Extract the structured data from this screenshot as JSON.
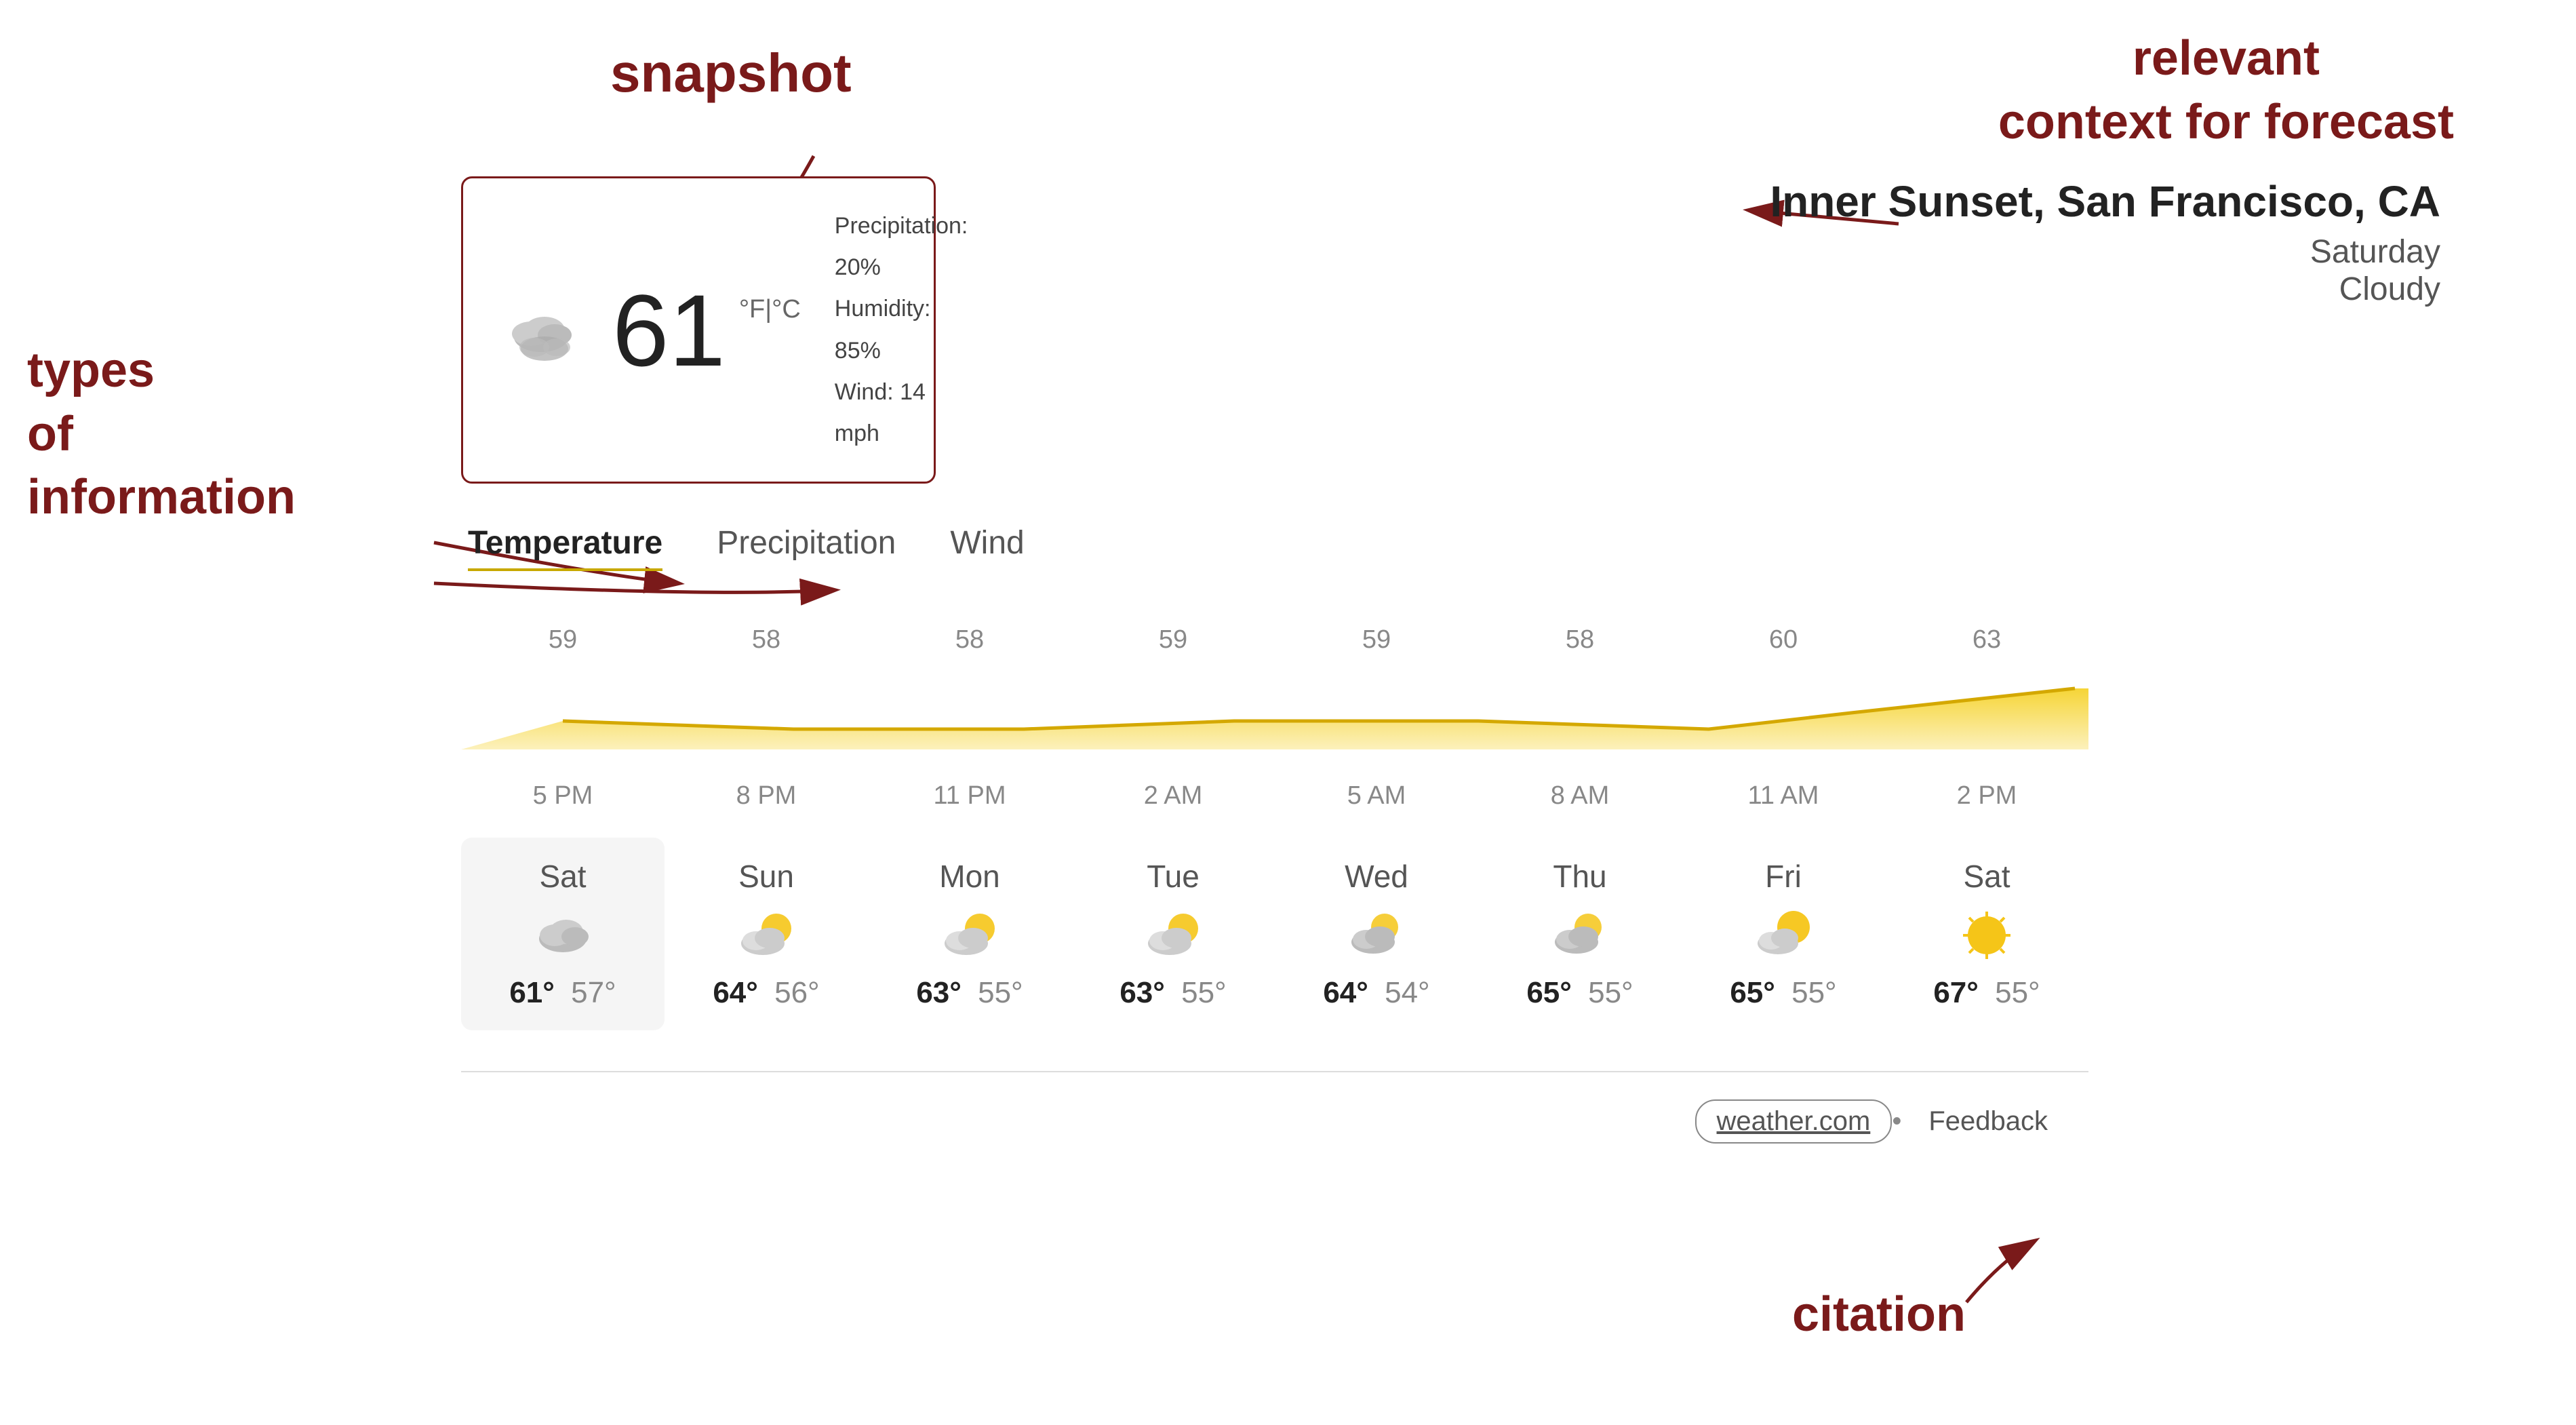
{
  "annotations": {
    "snapshot_label": "snapshot",
    "types_label": "types\nof\ninformation",
    "relevant_context_label": "relevant\ncontext for forecast",
    "citation_label": "citation"
  },
  "location": {
    "name": "Inner Sunset, San Francisco, CA",
    "day": "Saturday",
    "condition": "Cloudy"
  },
  "current_weather": {
    "temperature": "61",
    "units": "°F|°C",
    "precipitation": "Precipitation: 20%",
    "humidity": "Humidity: 85%",
    "wind": "Wind: 14 mph"
  },
  "tabs": [
    {
      "label": "Temperature",
      "active": true
    },
    {
      "label": "Precipitation",
      "active": false
    },
    {
      "label": "Wind",
      "active": false
    }
  ],
  "chart": {
    "temps": [
      "59",
      "58",
      "58",
      "59",
      "59",
      "58",
      "60",
      "63"
    ],
    "times": [
      "5 PM",
      "8 PM",
      "11 PM",
      "2 AM",
      "5 AM",
      "8 AM",
      "11 AM",
      "2 PM"
    ]
  },
  "daily_forecast": [
    {
      "day": "Sat",
      "high": "61°",
      "low": "57°",
      "icon": "cloudy",
      "active": true
    },
    {
      "day": "Sun",
      "high": "64°",
      "low": "56°",
      "icon": "partly-sunny",
      "active": false
    },
    {
      "day": "Mon",
      "high": "63°",
      "low": "55°",
      "icon": "partly-sunny",
      "active": false
    },
    {
      "day": "Tue",
      "high": "63°",
      "low": "55°",
      "icon": "partly-sunny",
      "active": false
    },
    {
      "day": "Wed",
      "high": "64°",
      "low": "54°",
      "icon": "partly-sunny",
      "active": false
    },
    {
      "day": "Thu",
      "high": "65°",
      "low": "55°",
      "icon": "partly-sunny",
      "active": false
    },
    {
      "day": "Fri",
      "high": "65°",
      "low": "55°",
      "icon": "partly-sunny",
      "active": false
    },
    {
      "day": "Sat",
      "high": "67°",
      "low": "55°",
      "icon": "sunny",
      "active": false
    }
  ],
  "citation": {
    "link_text": "weather.com",
    "feedback_text": "Feedback"
  }
}
